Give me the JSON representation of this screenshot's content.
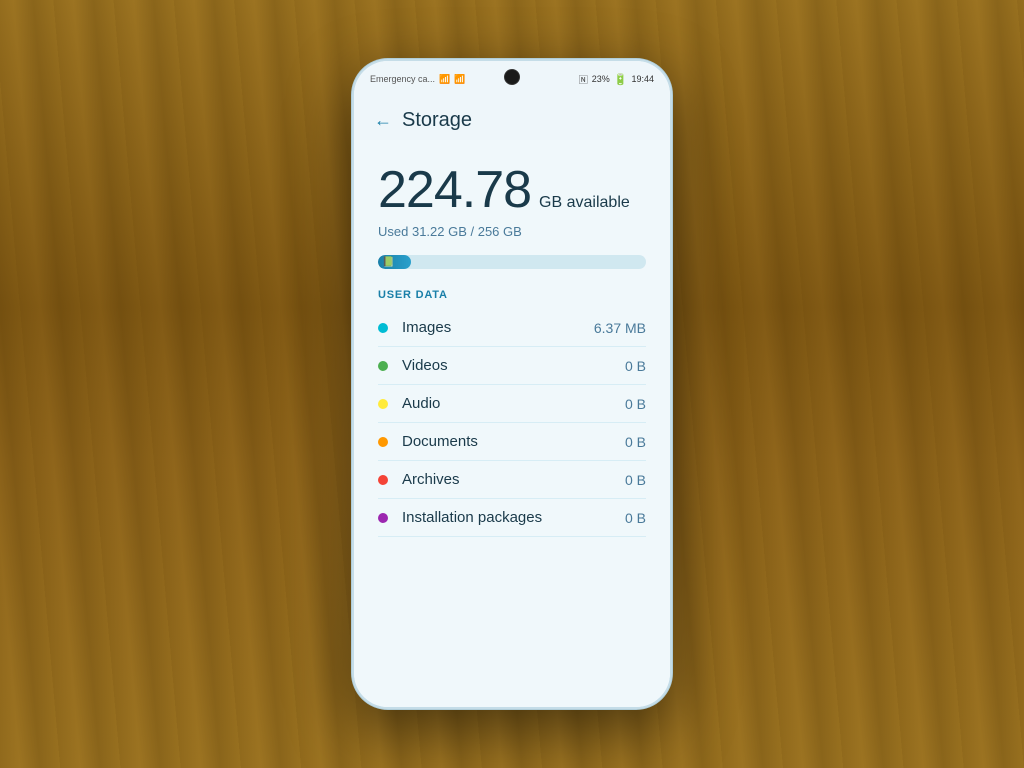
{
  "background": {
    "color": "#8B6914"
  },
  "status_bar": {
    "left_text": "Emergency ca...",
    "signal_icon": "signal",
    "wifi_icon": "wifi",
    "nfc_icon": "N",
    "battery_percent": "23%",
    "battery_icon": "battery",
    "time": "19:44"
  },
  "page": {
    "back_label": "←",
    "title": "Storage"
  },
  "storage": {
    "available_gb": "224.78",
    "available_label": "GB available",
    "used_text": "Used 31.22 GB / 256 GB",
    "progress_percent": 12.2
  },
  "section": {
    "title": "USER DATA"
  },
  "items": [
    {
      "name": "Images",
      "dot_color": "#00bcd4",
      "size": "6.37 MB"
    },
    {
      "name": "Videos",
      "dot_color": "#4caf50",
      "size": "0 B"
    },
    {
      "name": "Audio",
      "dot_color": "#ffeb3b",
      "size": "0 B"
    },
    {
      "name": "Documents",
      "dot_color": "#ff9800",
      "size": "0 B"
    },
    {
      "name": "Archives",
      "dot_color": "#f44336",
      "size": "0 B"
    },
    {
      "name": "Installation packages",
      "dot_color": "#9c27b0",
      "size": "0 B"
    }
  ]
}
